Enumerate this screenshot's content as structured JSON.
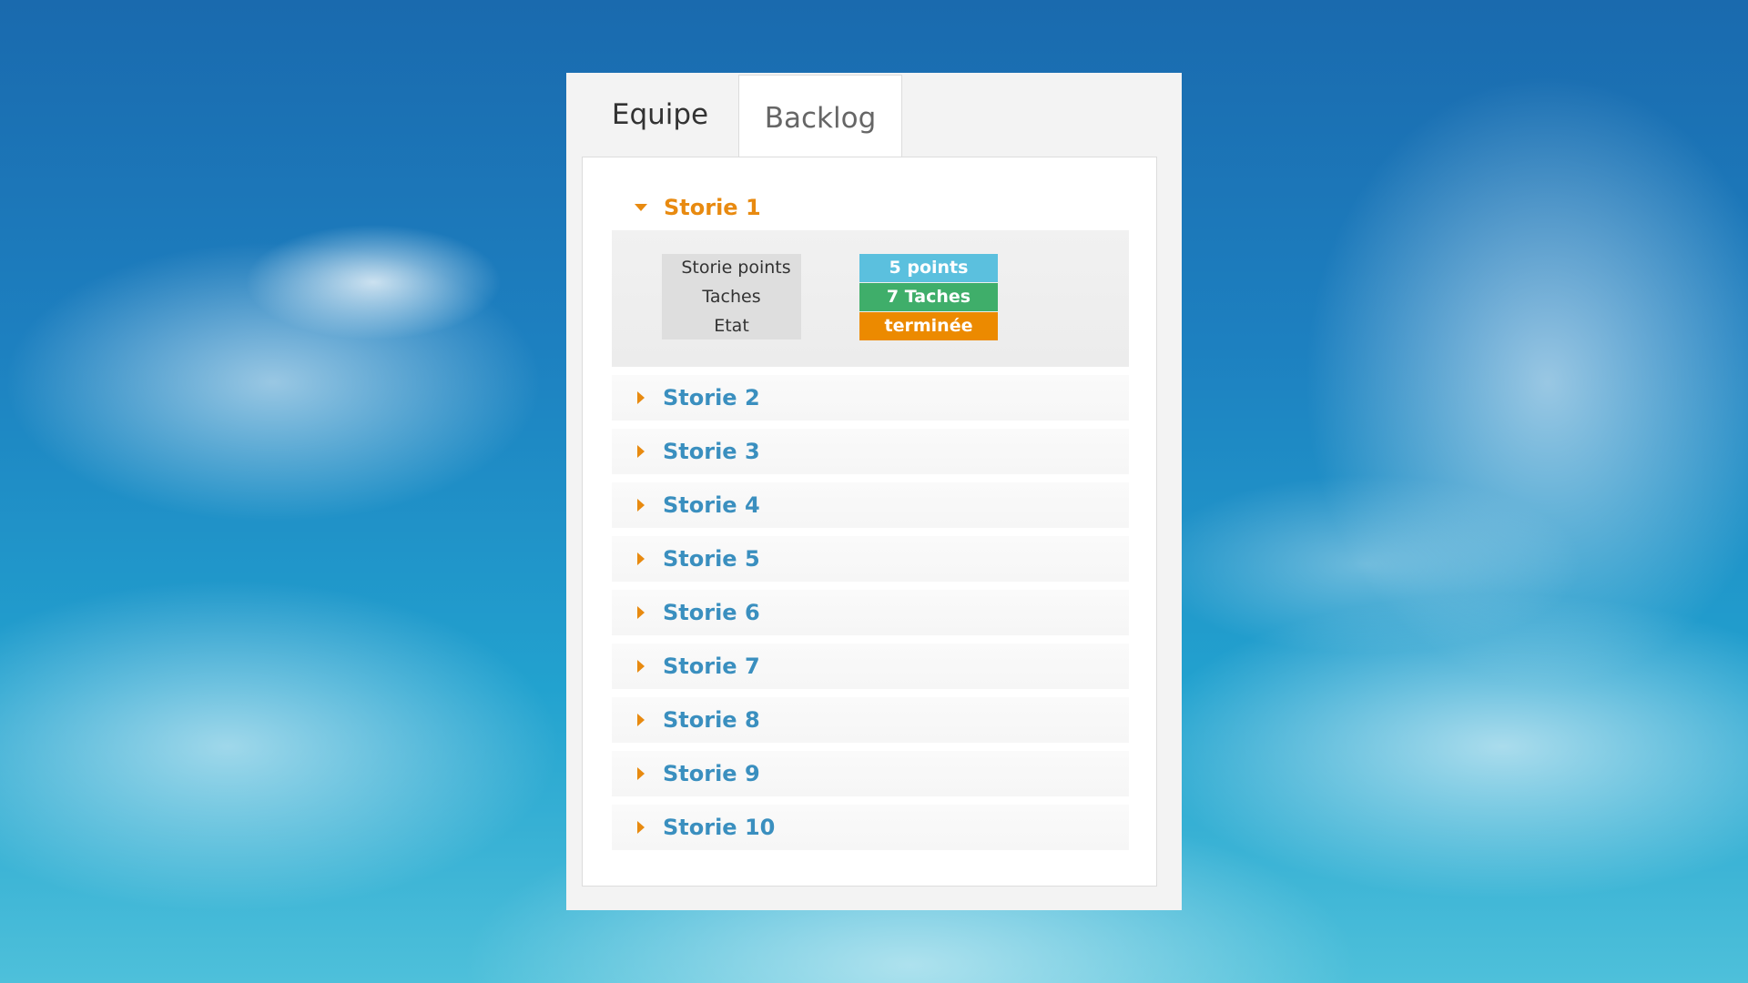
{
  "tabs": [
    {
      "label": "Equipe"
    },
    {
      "label": "Backlog"
    }
  ],
  "stories": [
    {
      "label": "Storie 1"
    },
    {
      "label": "Storie 2"
    },
    {
      "label": "Storie 3"
    },
    {
      "label": "Storie 4"
    },
    {
      "label": "Storie 5"
    },
    {
      "label": "Storie 6"
    },
    {
      "label": "Storie 7"
    },
    {
      "label": "Storie 8"
    },
    {
      "label": "Storie 9"
    },
    {
      "label": "Storie 10"
    }
  ],
  "expanded": {
    "labels": {
      "points": "Storie points",
      "tasks": "Taches",
      "state": "Etat"
    },
    "values": {
      "points": "5 points",
      "tasks": "7 Taches",
      "state": "terminée"
    }
  },
  "colors": {
    "points_badge": "#5bc0de",
    "tasks_badge": "#3fae6a",
    "state_badge": "#ec8a00",
    "accent_orange": "#e88a10",
    "link_blue": "#3a8fbf"
  },
  "icons": {
    "collapsed": "caret-right-icon",
    "expanded": "caret-down-icon"
  }
}
